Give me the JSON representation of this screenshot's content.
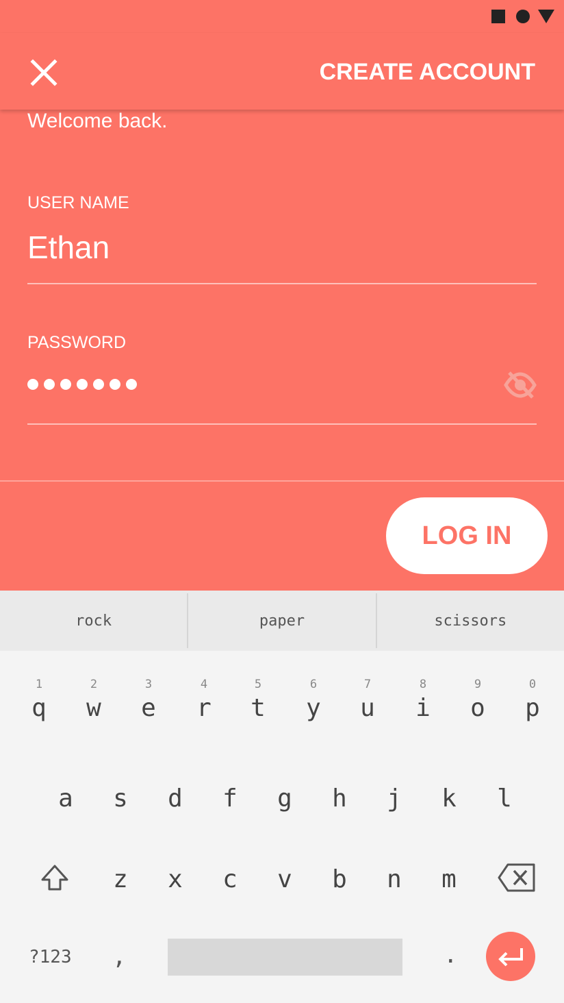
{
  "colors": {
    "accent": "#FD7366",
    "white": "#FFFFFF",
    "keyboard_bg": "#F4F4F4"
  },
  "status_bar": {
    "icons": [
      "square-icon",
      "circle-icon",
      "triangle-icon"
    ]
  },
  "app_bar": {
    "close_icon": "close-icon",
    "action_label": "CREATE ACCOUNT"
  },
  "form": {
    "welcome": "Welcome back.",
    "username": {
      "label": "USER NAME",
      "value": "Ethan"
    },
    "password": {
      "label": "PASSWORD",
      "masked_length": 7,
      "toggle_icon": "visibility-off-icon"
    },
    "login_label": "LOG IN"
  },
  "keyboard": {
    "suggestions": [
      "rock",
      "paper",
      "scissors"
    ],
    "row1": [
      {
        "num": "1",
        "ch": "q"
      },
      {
        "num": "2",
        "ch": "w"
      },
      {
        "num": "3",
        "ch": "e"
      },
      {
        "num": "4",
        "ch": "r"
      },
      {
        "num": "5",
        "ch": "t"
      },
      {
        "num": "6",
        "ch": "y"
      },
      {
        "num": "7",
        "ch": "u"
      },
      {
        "num": "8",
        "ch": "i"
      },
      {
        "num": "9",
        "ch": "o"
      },
      {
        "num": "0",
        "ch": "p"
      }
    ],
    "row2": [
      "a",
      "s",
      "d",
      "f",
      "g",
      "h",
      "j",
      "k",
      "l"
    ],
    "row3": [
      "z",
      "x",
      "c",
      "v",
      "b",
      "n",
      "m"
    ],
    "symbols_label": "?123",
    "comma": ",",
    "period": "."
  }
}
